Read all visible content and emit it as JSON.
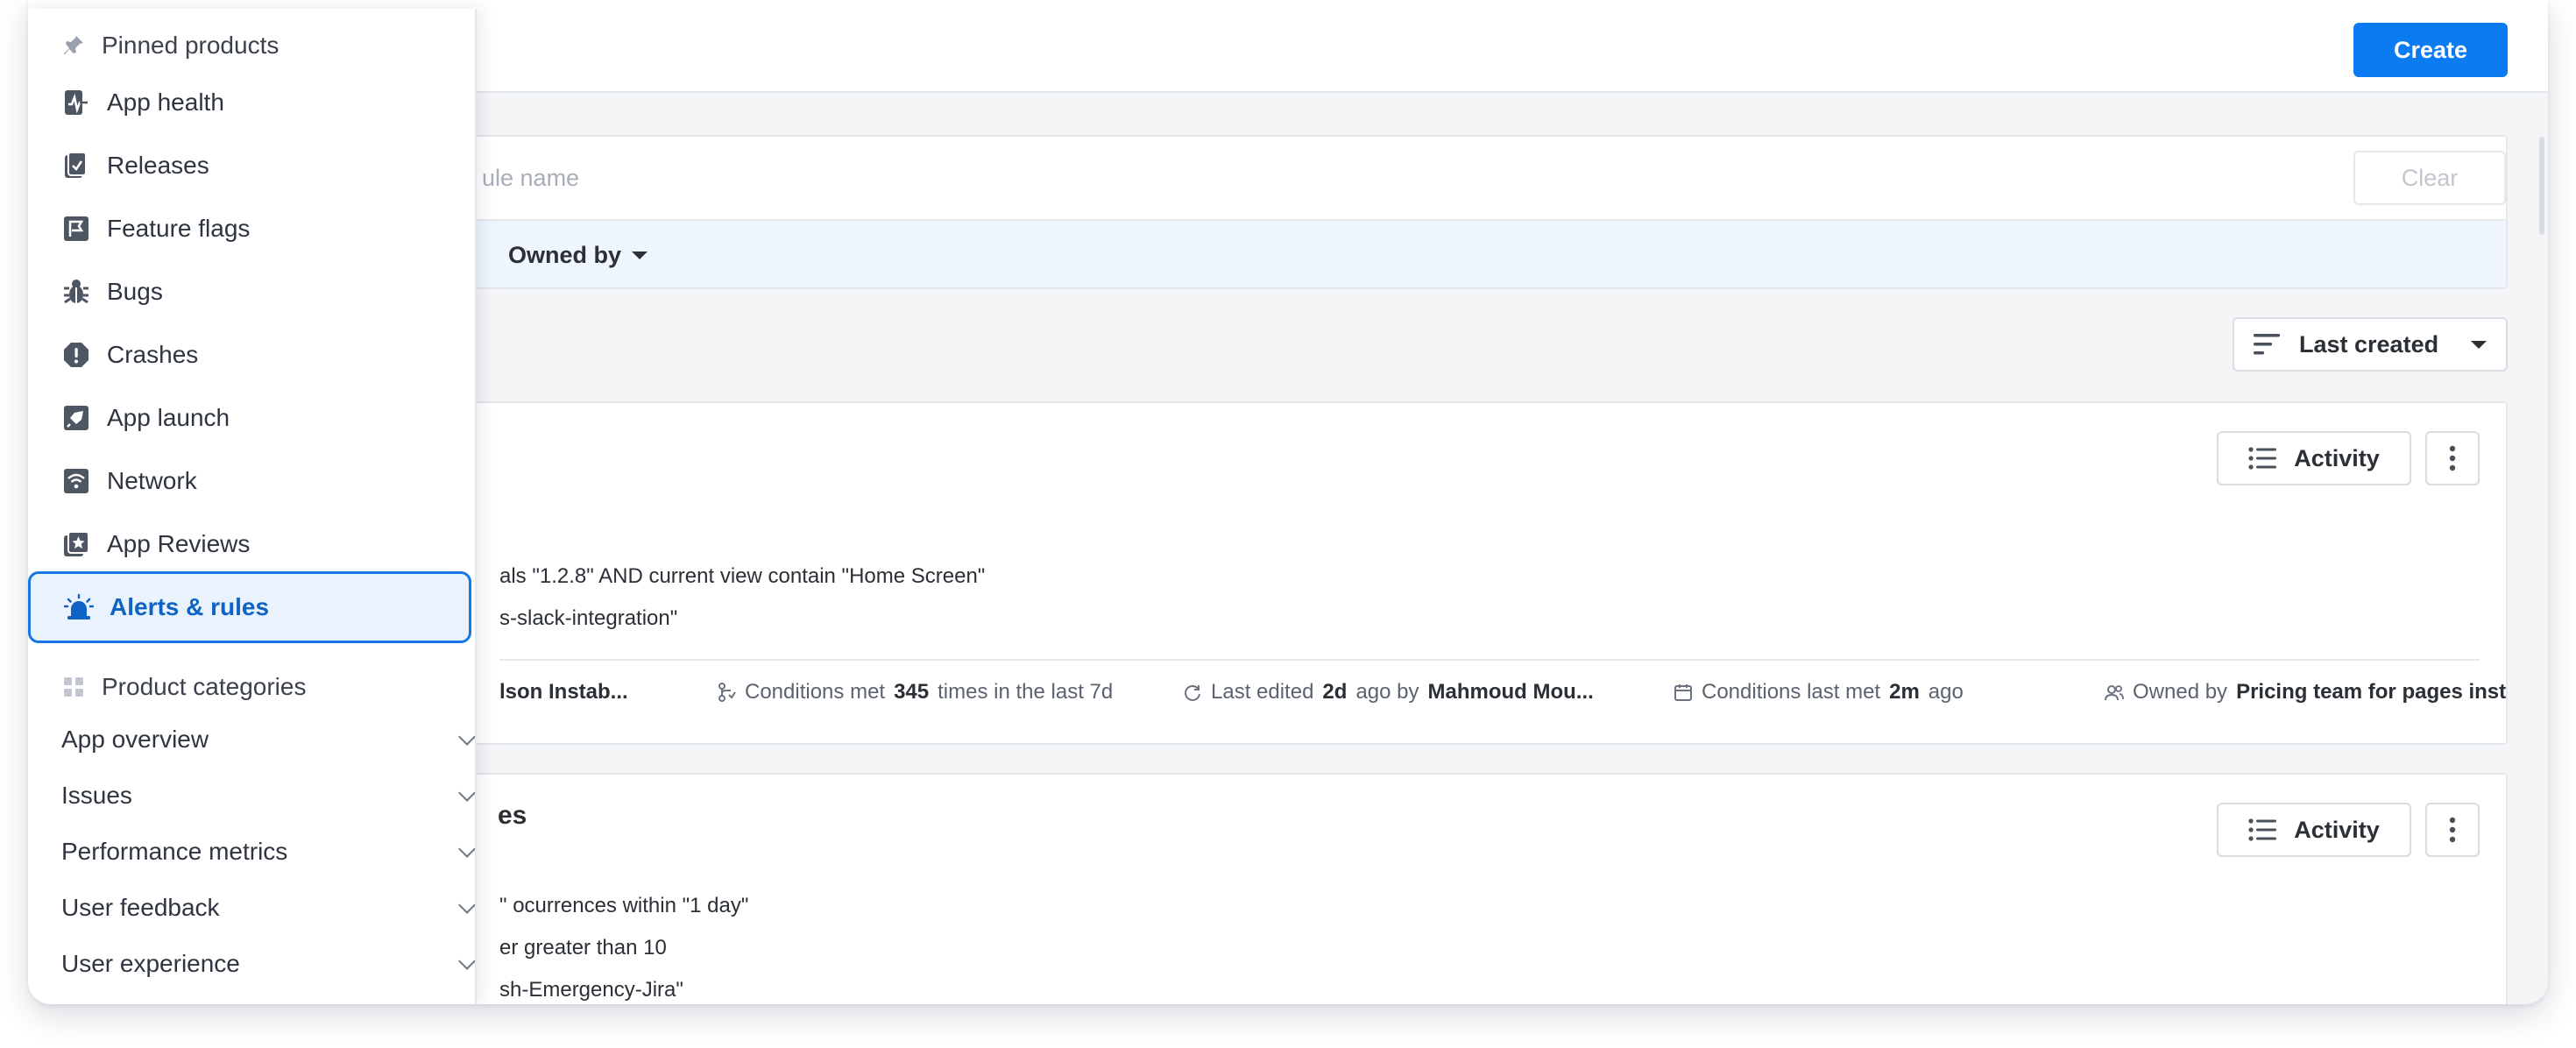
{
  "header": {
    "create_label": "Create"
  },
  "search": {
    "placeholder": "Search by rule name",
    "visible_fragment": "ule name",
    "clear_label": "Clear"
  },
  "filters": {
    "owned_by_label": "Owned by"
  },
  "sort": {
    "label": "Last created"
  },
  "rules": [
    {
      "title": "",
      "conditions": [
        "als \"1.2.8\" AND current view contain \"Home Screen\"",
        "s-slack-integration\""
      ],
      "activity_label": "Activity",
      "meta": {
        "creator": "lson Instab...",
        "conditions_met_prefix": "Conditions met",
        "conditions_met_count": "345",
        "conditions_met_suffix": "times in the last 7d",
        "last_edited_prefix": "Last edited",
        "last_edited_value": "2d",
        "last_edited_mid": "ago by",
        "last_edited_by": "Mahmoud Mou...",
        "conditions_last_met_prefix": "Conditions last met",
        "conditions_last_met_value": "2m",
        "conditions_last_met_suffix": "ago",
        "owned_by_prefix": "Owned by",
        "owned_by_value": "Pricing team for pages inst..."
      }
    },
    {
      "title": "es",
      "conditions": [
        "\" ocurrences within \"1 day\"",
        "er greater than 10",
        "sh-Emergency-Jira\""
      ],
      "activity_label": "Activity"
    }
  ],
  "nav_menu": {
    "pinned_header": "Pinned products",
    "pinned_items": [
      {
        "label": "App health",
        "icon": "app-health-icon"
      },
      {
        "label": "Releases",
        "icon": "releases-icon"
      },
      {
        "label": "Feature flags",
        "icon": "flag-icon"
      },
      {
        "label": "Bugs",
        "icon": "bug-icon"
      },
      {
        "label": "Crashes",
        "icon": "crash-icon"
      },
      {
        "label": "App launch",
        "icon": "rocket-icon"
      },
      {
        "label": "Network",
        "icon": "network-icon"
      },
      {
        "label": "App Reviews",
        "icon": "reviews-star-icon"
      },
      {
        "label": "Alerts & rules",
        "icon": "alarm-icon",
        "active": true
      }
    ],
    "categories_header": "Product categories",
    "categories": [
      {
        "label": "App overview"
      },
      {
        "label": "Issues"
      },
      {
        "label": "Performance metrics"
      },
      {
        "label": "User feedback"
      },
      {
        "label": "User experience"
      }
    ]
  },
  "colors": {
    "primary": "#0b7bf2",
    "active_bg": "#eaf3fd",
    "active_border": "#1677e6",
    "icon_gray": "#6b7280"
  }
}
